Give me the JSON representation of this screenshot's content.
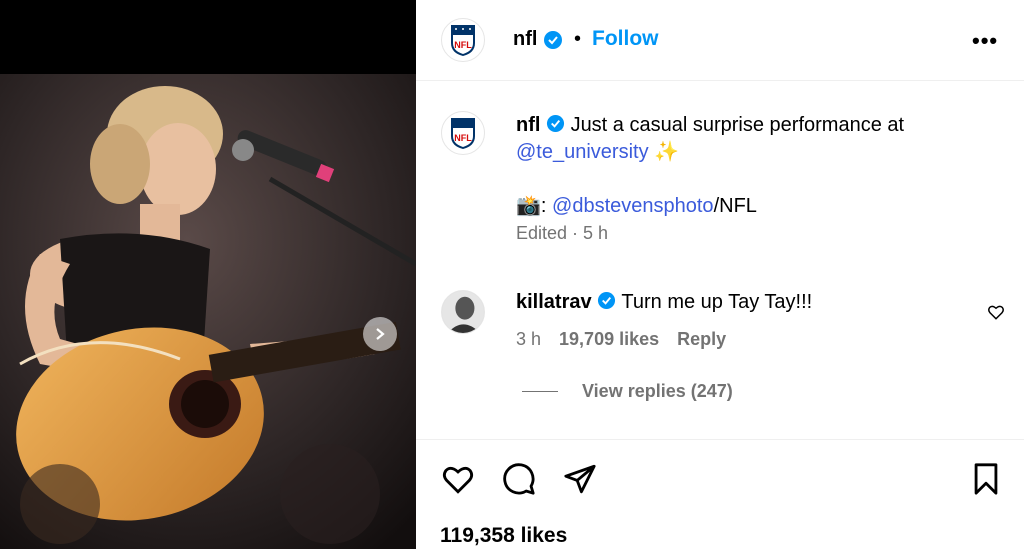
{
  "header": {
    "username": "nfl",
    "separator": "•",
    "follow_label": "Follow",
    "more_label": "•••"
  },
  "caption": {
    "username": "nfl",
    "text_start": "Just a casual surprise performance at",
    "mention1": "@te_university",
    "sparkle": "✨",
    "camera_emoji": "📸",
    "colon": ": ",
    "mention2": "@dbstevensphoto",
    "suffix": "/NFL",
    "meta": "Edited · 5 h"
  },
  "comment": {
    "username": "killatrav",
    "text": "Turn me up Tay Tay!!!",
    "time": "3 h",
    "likes": "19,709 likes",
    "reply_label": "Reply",
    "view_replies": "View replies (247)"
  },
  "post": {
    "likes": "119,358 likes"
  },
  "logo_text": "NFL",
  "colors": {
    "accent": "#0095f6",
    "mention": "#3b5bdb",
    "verified": "#0095f6",
    "nfl_blue": "#013369",
    "nfl_red": "#d50a0a",
    "muted": "#737373"
  },
  "icons": [
    "verified-icon",
    "heart-icon",
    "comment-icon",
    "share-icon",
    "bookmark-icon",
    "chevron-right-icon",
    "nfl-logo"
  ]
}
